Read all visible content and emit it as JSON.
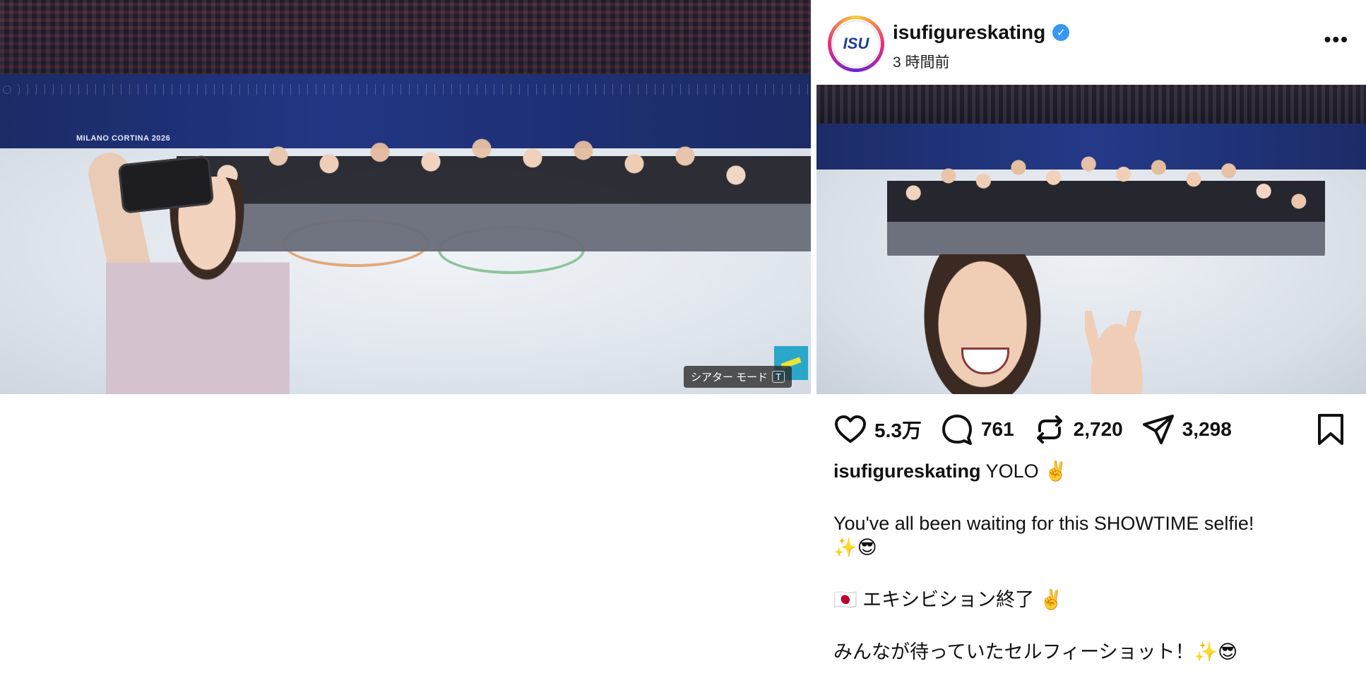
{
  "video": {
    "theater_tooltip": "シアター モード",
    "theater_shortcut": "T",
    "board_text": "MILANO CORTINA 2026"
  },
  "post": {
    "username": "isufigureskating",
    "avatar_text": "ISU",
    "time_ago": "3 時間前",
    "more": "•••",
    "actions": {
      "likes": "5.3万",
      "comments": "761",
      "reposts": "2,720",
      "shares": "3,298"
    },
    "caption": {
      "user": "isufigureskating",
      "first_line": "YOLO ✌️",
      "line2": "You've all been waiting for this SHOWTIME selfie!",
      "line3": "✨😎",
      "line4": "🇯🇵 エキシビション終了 ✌️",
      "line5": "みんなが待っていたセルフィーショット！✨😎"
    }
  },
  "colors": {
    "verified": "#3897f0",
    "accent_avatar_ring": "#ee2a7b"
  }
}
